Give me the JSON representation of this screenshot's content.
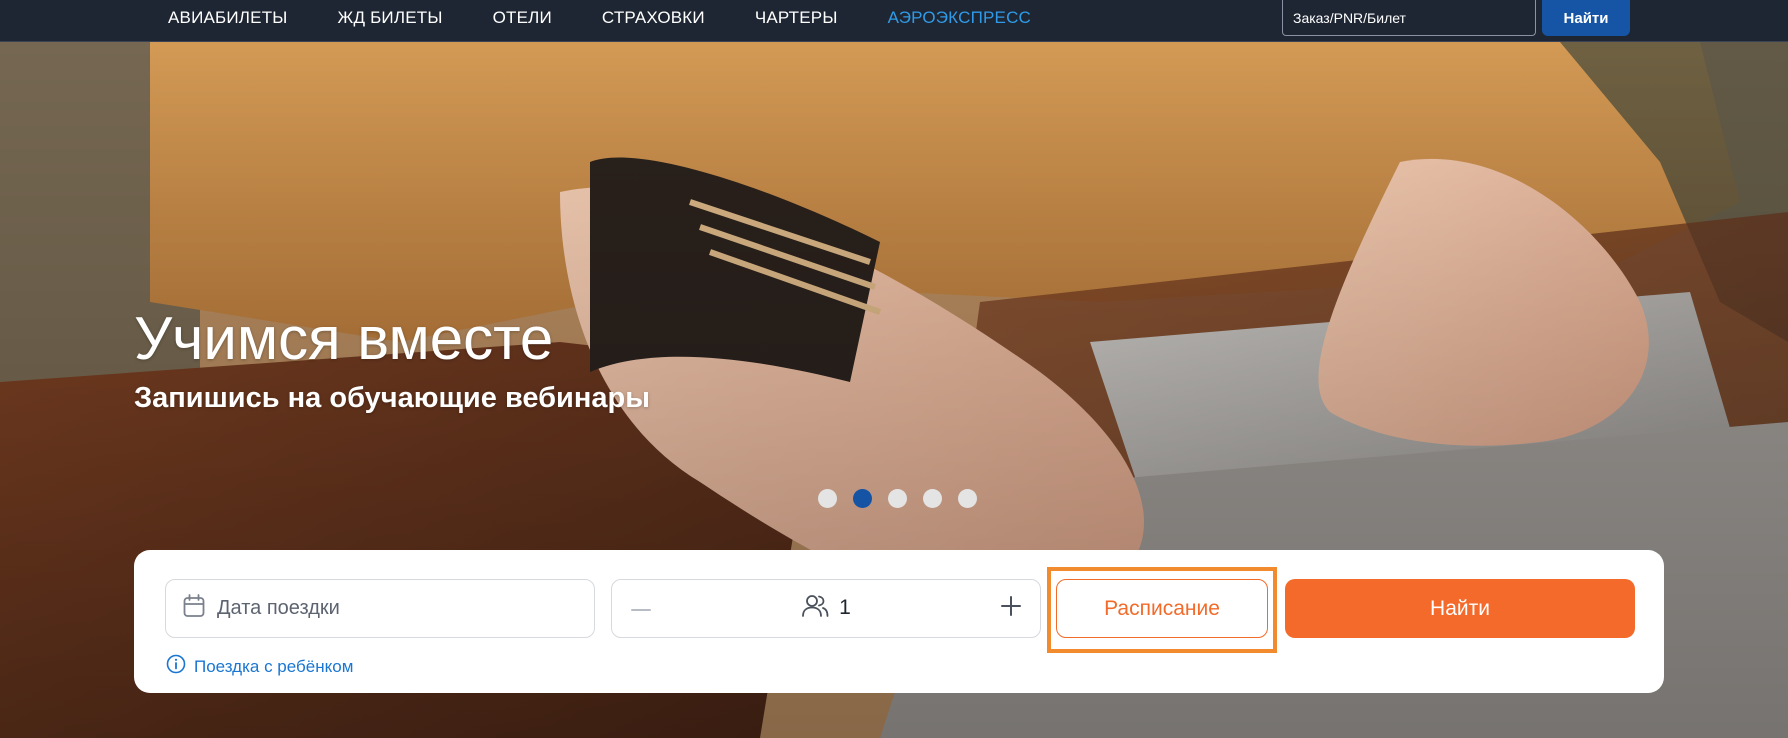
{
  "nav": {
    "items": [
      {
        "label": "АВИАБИЛЕТЫ",
        "active": false
      },
      {
        "label": "ЖД БИЛЕТЫ",
        "active": false
      },
      {
        "label": "ОТЕЛИ",
        "active": false
      },
      {
        "label": "СТРАХОВКИ",
        "active": false
      },
      {
        "label": "ЧАРТЕРЫ",
        "active": false
      },
      {
        "label": "АЭРОЭКСПРЕСС",
        "active": true
      }
    ],
    "order_search": {
      "placeholder": "Заказ/PNR/Билет",
      "button_label": "Найти"
    }
  },
  "hero": {
    "title": "Учимся вместе",
    "subtitle": "Запишись на обучающие вебинары",
    "slides_count": 5,
    "active_slide": 2
  },
  "search": {
    "date_placeholder": "Дата поездки",
    "date_icon": "calendar-icon",
    "passengers": {
      "icon": "users-icon",
      "value": "1",
      "minus_icon": "minus-icon",
      "plus_icon": "plus-icon"
    },
    "schedule_label": "Расписание",
    "search_label": "Найти",
    "child_trip_label": "Поездка с ребёнком",
    "child_trip_icon": "info-icon"
  },
  "colors": {
    "topbar_bg": "#1f2633",
    "nav_active": "#2f9be8",
    "order_button": "#1655a6",
    "accent_orange": "#f36a2a",
    "highlight": "#f28a2e",
    "dot_active": "#1553a5",
    "link_blue": "#1a76d2"
  }
}
